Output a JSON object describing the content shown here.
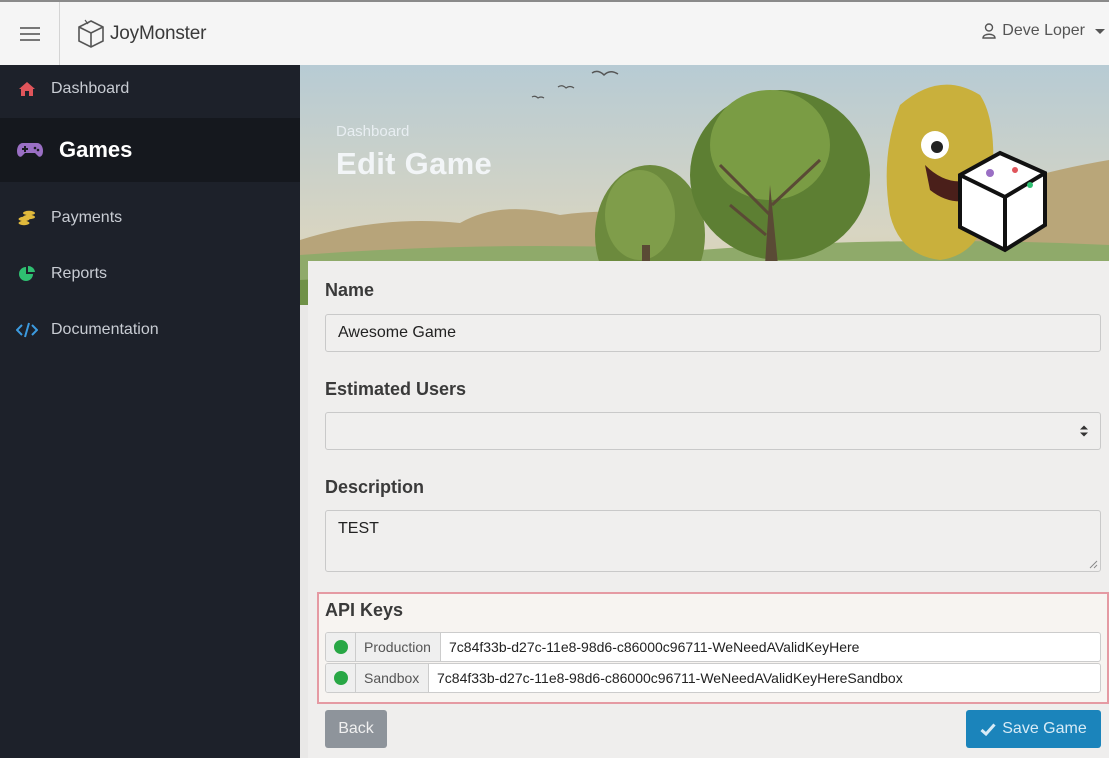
{
  "header": {
    "brand": "JoyMonster",
    "user_name": "Deve Loper"
  },
  "sidebar": {
    "items": [
      {
        "label": "Dashboard",
        "icon": "home-icon",
        "color": "#e0555b"
      },
      {
        "label": "Games",
        "icon": "gamepad-icon",
        "color": "#9a6fc4",
        "active": true
      },
      {
        "label": "Payments",
        "icon": "coins-icon",
        "color": "#e0b93c"
      },
      {
        "label": "Reports",
        "icon": "pie-chart-icon",
        "color": "#2fbf71"
      },
      {
        "label": "Documentation",
        "icon": "code-icon",
        "color": "#3c9be0"
      }
    ]
  },
  "hero": {
    "breadcrumb": "Dashboard",
    "title": "Edit Game"
  },
  "form": {
    "name_label": "Name",
    "name_value": "Awesome Game",
    "users_label": "Estimated Users",
    "users_value": "",
    "description_label": "Description",
    "description_value": "TEST"
  },
  "api_keys": {
    "title": "API Keys",
    "keys": [
      {
        "env": "Production",
        "value": "7c84f33b-d27c-11e8-98d6-c86000c96711-WeNeedAValidKeyHere",
        "status_color": "#28a745"
      },
      {
        "env": "Sandbox",
        "value": "7c84f33b-d27c-11e8-98d6-c86000c96711-WeNeedAValidKeyHereSandbox",
        "status_color": "#28a745"
      }
    ]
  },
  "actions": {
    "back_label": "Back",
    "save_label": "Save Game"
  },
  "colors": {
    "sidebar_bg": "#1d212a",
    "primary": "#1b84bb",
    "highlight_border": "#e59aa3",
    "status_ok": "#28a745"
  }
}
